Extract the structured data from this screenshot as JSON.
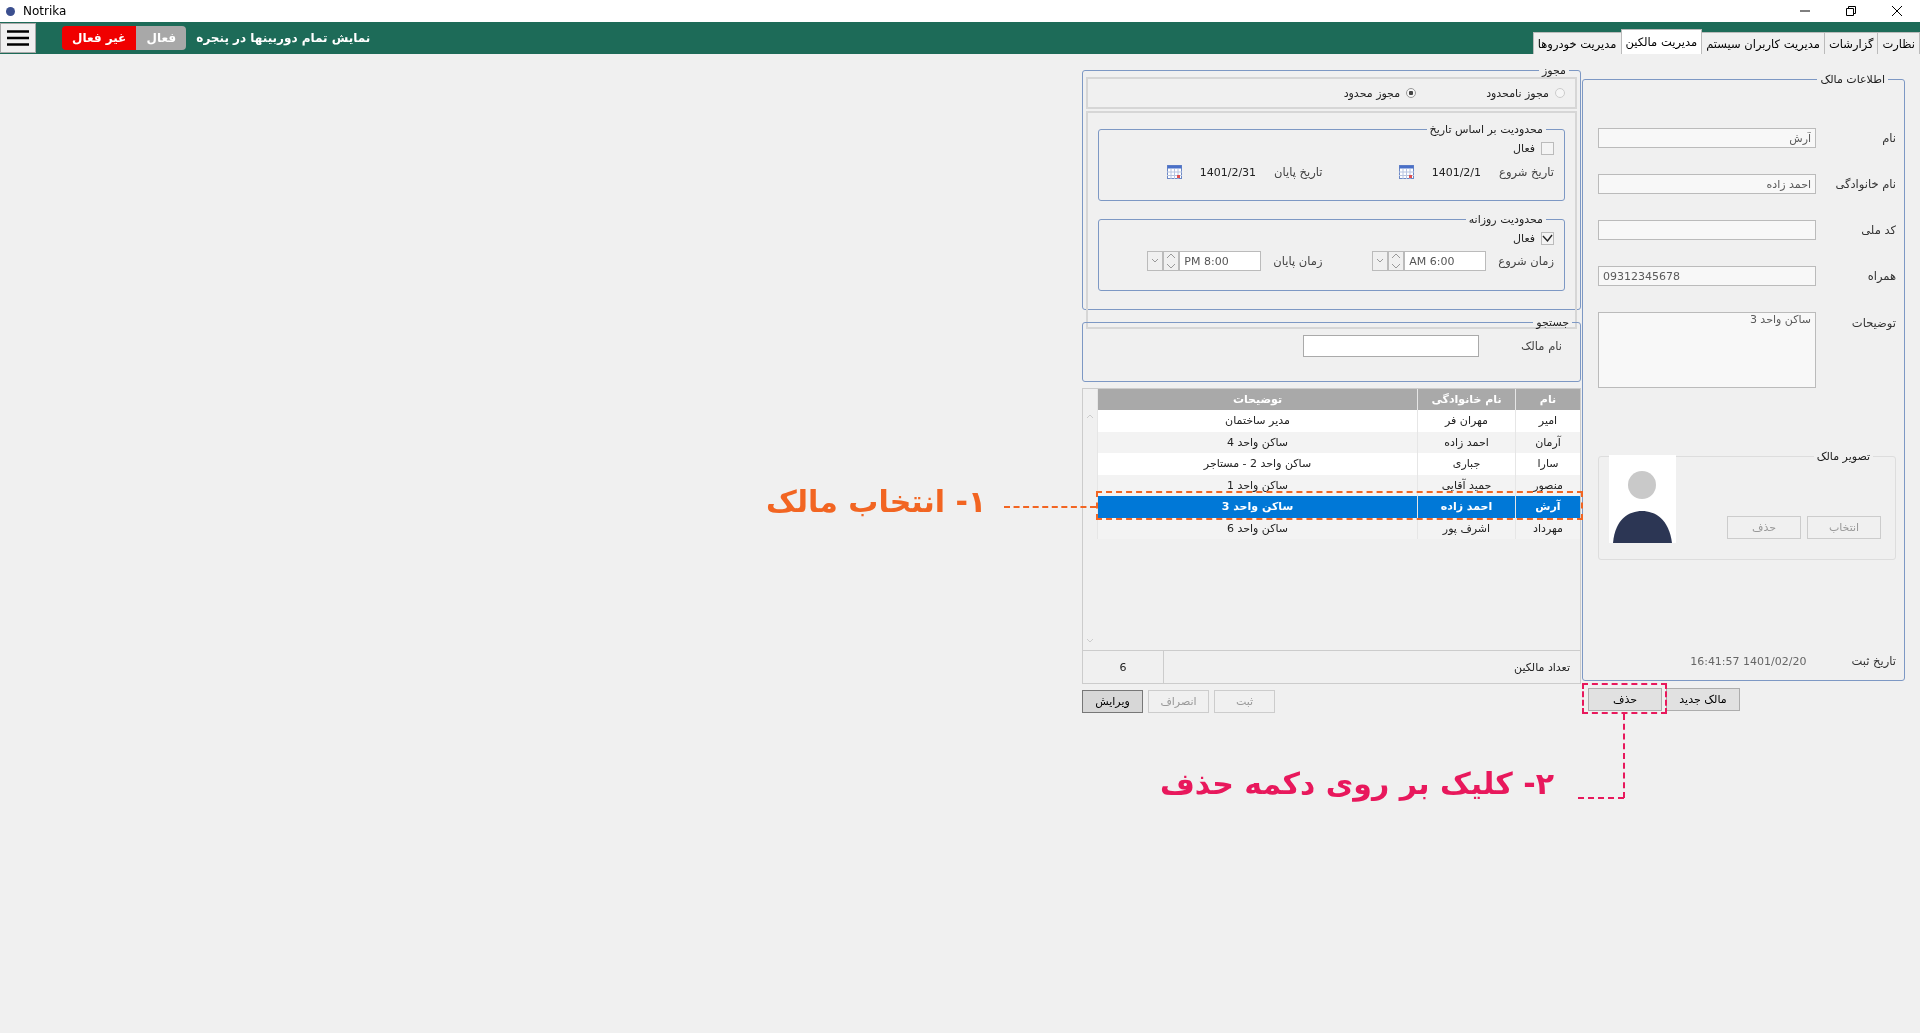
{
  "window": {
    "title": "Notrika"
  },
  "toolbar": {
    "toggle": [
      {
        "label": "فعال",
        "selected": false
      },
      {
        "label": "غیر فعال",
        "selected": true
      }
    ],
    "caption": "نمایش تمام دوربینها در پنجره"
  },
  "tabs": [
    {
      "label": "نظارت",
      "selected": false
    },
    {
      "label": "گزارشات",
      "selected": false
    },
    {
      "label": "مدیریت کاربران سیستم",
      "selected": false
    },
    {
      "label": "مدیریت مالکین",
      "selected": true
    },
    {
      "label": "مدیریت خودروها",
      "selected": false
    }
  ],
  "owner_info": {
    "title": "اطلاعات مالک",
    "fields": [
      {
        "label": "نام",
        "value": "آرش"
      },
      {
        "label": "نام خانوادگی",
        "value": "احمد زاده"
      },
      {
        "label": "کد ملی"
      },
      {
        "label": "همراه",
        "value": "09312345678"
      }
    ],
    "notes": {
      "label": "توضیحات",
      "value": "ساکن واحد 3"
    },
    "photo": {
      "title": "تصویر مالک",
      "buttons": [
        "انتخاب",
        "حذف"
      ]
    },
    "registered": {
      "label": "تاریخ ثبت",
      "value": "16:41:57 1401/02/20"
    }
  },
  "owner_buttons": [
    {
      "label": "مالک جدید"
    },
    {
      "label": "حذف"
    }
  ],
  "permit": {
    "title": "مجوز",
    "options": [
      {
        "label": "مجوز نامحدود",
        "selected": false
      },
      {
        "label": "مجوز محدود",
        "selected": true
      }
    ],
    "date_limit": {
      "title": "محدودیت بر اساس تاریخ",
      "active": {
        "label": "فعال",
        "checked": false
      },
      "start": {
        "label": "تاریخ شروع",
        "value": "1401/2/1"
      },
      "end": {
        "label": "تاریخ پایان",
        "value": "1401/2/31"
      }
    },
    "daily_limit": {
      "title": "محدودیت روزانه",
      "active": {
        "label": "فعال",
        "checked": true
      },
      "start": {
        "label": "زمان شروع",
        "value": "AM 6:00"
      },
      "end": {
        "label": "زمان پایان",
        "value": "PM 8:00"
      }
    }
  },
  "search": {
    "title": "جستجو",
    "label": "نام مالک"
  },
  "table": {
    "columns": [
      "نام",
      "نام خانوادگی",
      "توضیحات"
    ],
    "rows": [
      {
        "cells": [
          "امیر",
          "مهران فر",
          "مدیر ساختمان"
        ],
        "selected": false
      },
      {
        "cells": [
          "آرمان",
          "احمد زاده",
          "ساکن واحد 4"
        ],
        "selected": false
      },
      {
        "cells": [
          "سارا",
          "جباری",
          "ساکن واحد 2 - مستاجر"
        ],
        "selected": false
      },
      {
        "cells": [
          "منصور",
          "حمید آقایی",
          "ساکن واحد 1"
        ],
        "selected": false
      },
      {
        "cells": [
          "آرش",
          "احمد زاده",
          "ساکن واحد 3"
        ],
        "selected": true
      },
      {
        "cells": [
          "مهرداد",
          "اشرف پور",
          "ساکن واحد 6"
        ],
        "selected": false
      }
    ]
  },
  "count": {
    "label": "تعداد مالکین",
    "value": "6"
  },
  "actions": [
    {
      "label": "ثبت",
      "disabled": true
    },
    {
      "label": "انصراف",
      "disabled": true
    },
    {
      "label": "ویرایش",
      "disabled": false
    }
  ],
  "annotations": [
    {
      "kind": "select",
      "text": "۱- انتخاب مالک",
      "color": "#f26522"
    },
    {
      "kind": "click",
      "text": "۲- کلیک بر روی دکمه حذف",
      "color": "#e8185c"
    }
  ]
}
